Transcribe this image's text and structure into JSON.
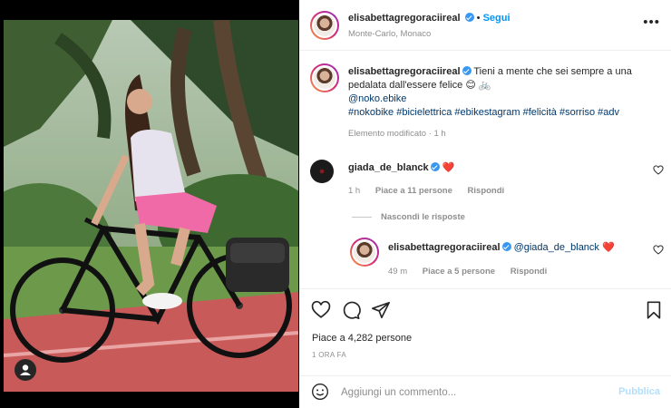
{
  "header": {
    "username": "elisabettagregoraciireal",
    "follow_label": "Segui",
    "location": "Monte-Carlo, Monaco",
    "more_label": "•••"
  },
  "caption": {
    "username": "elisabettagregoraciireal",
    "text_line1": "Tieni a mente che sei sempre a una",
    "text_line2": "pedalata dall'essere felice",
    "emoji": "😊 🚲",
    "mention": "@noko.ebike",
    "hashtags": "#nokobike #bicielettrica #ebikestagram #felicità #sorriso #adv",
    "meta": "Elemento modificato · 1 h"
  },
  "comments": [
    {
      "username": "giada_de_blanck",
      "text": "❤️",
      "time": "1 h",
      "likes": "Piace a 11 persone",
      "reply": "Rispondi"
    }
  ],
  "hide_replies_label": "Nascondi le risposte",
  "reply": {
    "username": "elisabettagregoraciireal",
    "mention": "@giada_de_blanck",
    "text": "❤️",
    "time": "49 m",
    "likes": "Piace a 5 persone",
    "reply": "Rispondi"
  },
  "post": {
    "likes": "Piace a 4,282 persone",
    "time_ago": "1 ORA FA"
  },
  "comment_box": {
    "placeholder": "Aggiungi un commento...",
    "publish_label": "Pubblica"
  },
  "colors": {
    "accent": "#0095f6",
    "verified": "#3897f0",
    "heart": "#ed4956"
  },
  "icons": [
    "heart-icon",
    "comment-icon",
    "share-icon",
    "bookmark-icon",
    "emoji-icon",
    "user-tag-icon",
    "more-icon"
  ]
}
